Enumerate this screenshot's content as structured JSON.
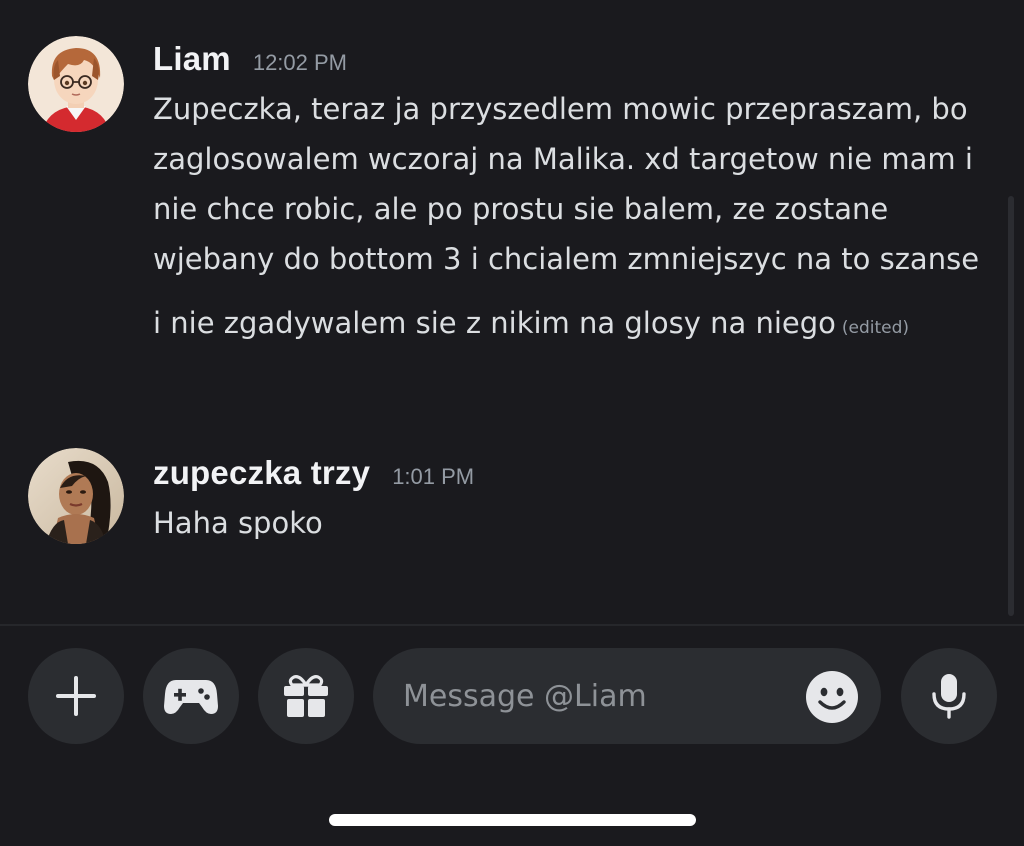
{
  "conversation": {
    "messages": [
      {
        "author": "Liam",
        "timestamp": "12:02 PM",
        "avatar_icon": "anime-boy-avatar",
        "paragraphs": [
          "Zupeczka, teraz ja przyszedlem mowic przepraszam, bo zaglosowalem wczoraj na Malika. xd targetow nie mam i nie chce robic, ale po prostu sie balem, ze zostane wjebany do bottom 3 i chcialem zmniejszyc na to szanse",
          "i nie zgadywalem sie z nikim na glosy na niego"
        ],
        "edited_label": "(edited)"
      },
      {
        "author": "zupeczka trzy",
        "timestamp": "1:01 PM",
        "avatar_icon": "woman-photo-avatar",
        "paragraphs": [
          "Haha spoko"
        ]
      }
    ]
  },
  "composer": {
    "add_icon": "plus-icon",
    "games_icon": "gamepad-icon",
    "gift_icon": "gift-icon",
    "placeholder": "Message @Liam",
    "emoji_icon": "emoji-icon",
    "mic_icon": "microphone-icon"
  },
  "colors": {
    "background": "#1a1a1e",
    "button_bg": "#2b2d31",
    "text": "#dbdee1",
    "muted": "#949ba4"
  }
}
